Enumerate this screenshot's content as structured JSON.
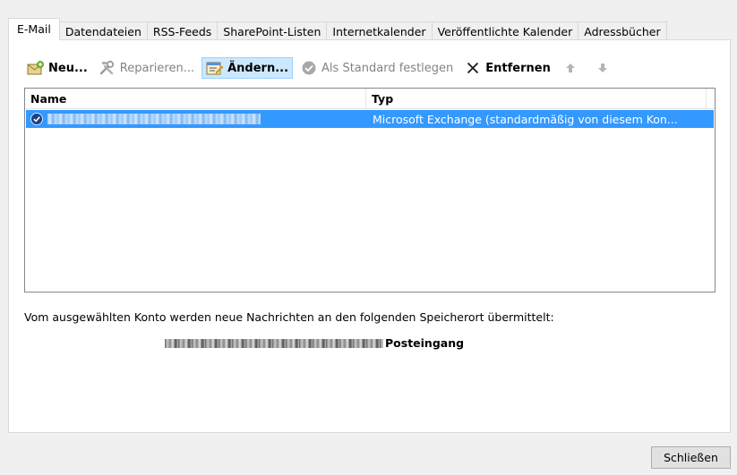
{
  "tabs": [
    {
      "label": "E-Mail",
      "active": true
    },
    {
      "label": "Datendateien",
      "active": false
    },
    {
      "label": "RSS-Feeds",
      "active": false
    },
    {
      "label": "SharePoint-Listen",
      "active": false
    },
    {
      "label": "Internetkalender",
      "active": false
    },
    {
      "label": "Veröffentlichte Kalender",
      "active": false
    },
    {
      "label": "Adressbücher",
      "active": false
    }
  ],
  "toolbar": {
    "new_label": "Neu...",
    "repair_label": "Reparieren...",
    "change_label": "Ändern...",
    "set_default_label": "Als Standard festlegen",
    "remove_label": "Entfernen"
  },
  "accounts_list": {
    "columns": {
      "name": "Name",
      "type": "Typ"
    },
    "rows": [
      {
        "type": "Microsoft Exchange (standardmäßig von diesem Kon..."
      }
    ]
  },
  "delivery": {
    "info": "Vom ausgewählten Konto werden neue Nachrichten an den folgenden Speicherort übermittelt:",
    "folder": "Posteingang"
  },
  "footer": {
    "close_label": "Schließen"
  },
  "colors": {
    "selection": "#3399ff",
    "toolbar_selected": "#cce8ff",
    "disabled_text": "#838383"
  },
  "icons": {
    "new": "new-account-envelope-icon",
    "repair": "repair-tools-icon",
    "change": "change-settings-icon",
    "set_default": "checkmark-circle-icon",
    "remove": "close-x-icon",
    "move_up": "arrow-up-icon",
    "move_down": "arrow-down-icon"
  }
}
